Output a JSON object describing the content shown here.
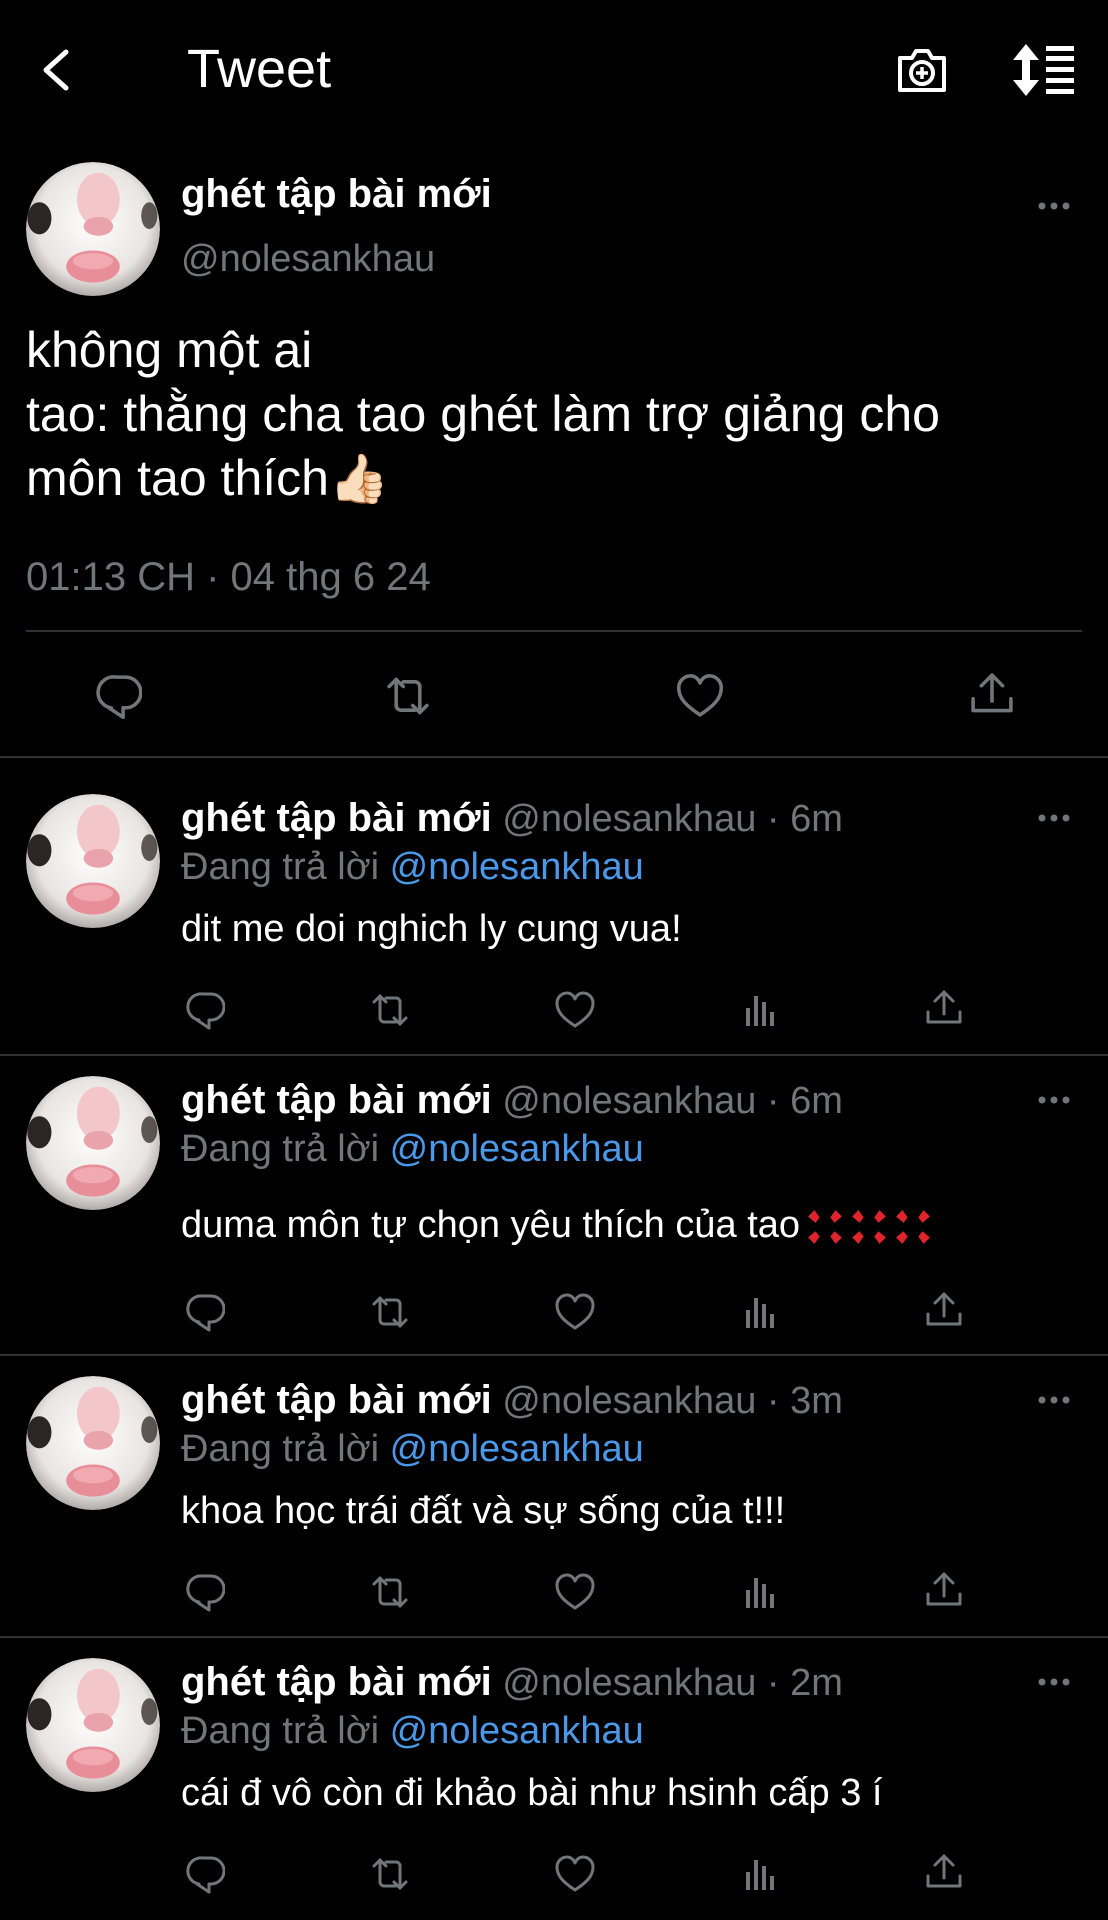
{
  "header": {
    "title": "Tweet"
  },
  "main_tweet": {
    "display_name": "ghét tập bài mới",
    "handle": "@nolesankhau",
    "line1": "không một ai",
    "line2": "tao: thằng cha tao ghét làm trợ giảng cho",
    "line3": "môn tao thích",
    "emoji": "👍🏻",
    "timestamp": "01:13 CH · 04 thg 6 24"
  },
  "replies": [
    {
      "display_name": "ghét tập bài mới",
      "meta": "@nolesankhau · 6m",
      "replying_prefix": "Đang trả lời",
      "replying_to": "@nolesankhau",
      "text": "dit me doi nghich ly cung vua!"
    },
    {
      "display_name": "ghét tập bài mới",
      "meta": "@nolesankhau · 6m",
      "replying_prefix": "Đang trả lời",
      "replying_to": "@nolesankhau",
      "text": "duma môn tự chọn yêu thích của tao"
    },
    {
      "display_name": "ghét tập bài mới",
      "meta": "@nolesankhau · 3m",
      "replying_prefix": "Đang trả lời",
      "replying_to": "@nolesankhau",
      "text": "khoa học trái đất và sự sống của t!!!"
    },
    {
      "display_name": "ghét tập bài mới",
      "meta": "@nolesankhau · 2m",
      "replying_prefix": "Đang trả lời",
      "replying_to": "@nolesankhau",
      "text": "cái đ vô còn đi khảo bài như hsinh cấp 3 í"
    }
  ],
  "colors": {
    "background": "#000000",
    "text": "#ffffff",
    "secondary": "#71767b",
    "link": "#4a99e9",
    "divider": "#2f3336",
    "anger_emoji": "#e0242b"
  },
  "icons": [
    "back-arrow-icon",
    "camera-icon",
    "sort-icon",
    "more-icon",
    "reply-icon",
    "retweet-icon",
    "like-icon",
    "views-icon",
    "share-icon",
    "anger-emoji-icon"
  ]
}
